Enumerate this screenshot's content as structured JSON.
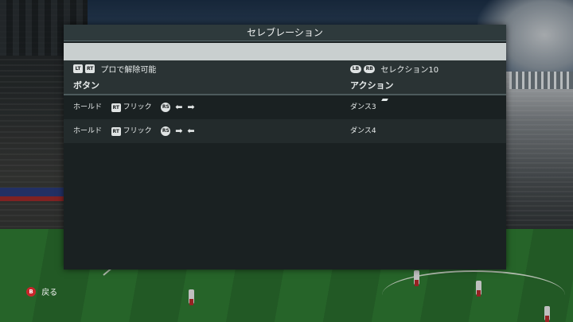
{
  "panel": {
    "title": "セレブレーション"
  },
  "filter": {
    "left_buttons": [
      "LT",
      "RT"
    ],
    "left_label": "プロで解除可能",
    "right_buttons": [
      "LB",
      "RB"
    ],
    "right_label": "セレクション10"
  },
  "table": {
    "headers": {
      "button": "ボタン",
      "action": "アクション"
    },
    "rows": [
      {
        "hold": "ホールド",
        "trigger": "RT",
        "flick": "フリック",
        "stick": "RS",
        "arrow1": "⬅",
        "arrow2": "➡",
        "action": "ダンス3"
      },
      {
        "hold": "ホールド",
        "trigger": "RT",
        "flick": "フリック",
        "stick": "RS",
        "arrow1": "➡",
        "arrow2": "⬅",
        "action": "ダンス4"
      }
    ]
  },
  "footer": {
    "back_button": "B",
    "back_label": "戻る"
  },
  "colors": {
    "panel_bg": "#1a2122",
    "highlight_strip": "#c9cfcf",
    "back_button": "#c8262b",
    "pitch": "#2c7330"
  }
}
